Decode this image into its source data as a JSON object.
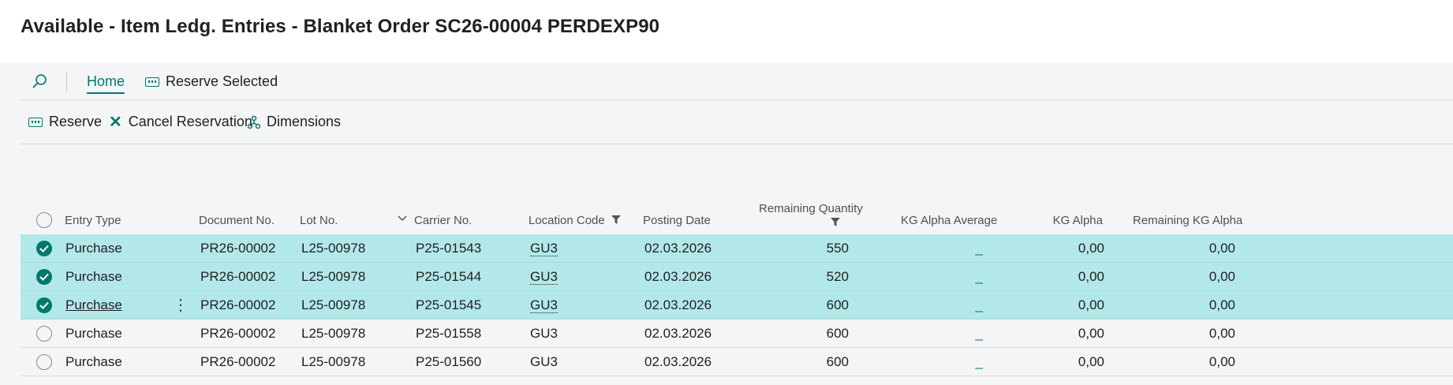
{
  "page": {
    "title": "Available - Item Ledg. Entries - Blanket Order SC26-00004 PERDEXP90"
  },
  "nav": {
    "home_label": "Home",
    "reserve_selected_label": "Reserve Selected"
  },
  "actions": {
    "reserve_label": "Reserve",
    "cancel_reservation_label": "Cancel Reservation",
    "dimensions_label": "Dimensions"
  },
  "columns": {
    "entry_type": "Entry Type",
    "document_no": "Document No.",
    "lot_no": "Lot No.",
    "carrier_no": "Carrier No.",
    "location_code": "Location Code",
    "posting_date": "Posting Date",
    "remaining_quantity": "Remaining Quantity",
    "kg_alpha_average": "KG Alpha Average",
    "kg_alpha": "KG Alpha",
    "remaining_kg_alpha": "Remaining KG Alpha"
  },
  "rows": [
    {
      "selected": true,
      "entry_type": "Purchase",
      "document_no": "PR26-00002",
      "lot_no": "L25-00978",
      "carrier_no": "P25-01543",
      "location_code": "GU3",
      "posting_date": "02.03.2026",
      "remaining_quantity": "550",
      "kg_alpha_average": "_",
      "kg_alpha": "0,00",
      "remaining_kg_alpha": "0,00"
    },
    {
      "selected": true,
      "entry_type": "Purchase",
      "document_no": "PR26-00002",
      "lot_no": "L25-00978",
      "carrier_no": "P25-01544",
      "location_code": "GU3",
      "posting_date": "02.03.2026",
      "remaining_quantity": "520",
      "kg_alpha_average": "_",
      "kg_alpha": "0,00",
      "remaining_kg_alpha": "0,00"
    },
    {
      "selected": true,
      "entry_type": "Purchase",
      "document_no": "PR26-00002",
      "lot_no": "L25-00978",
      "carrier_no": "P25-01545",
      "location_code": "GU3",
      "posting_date": "02.03.2026",
      "remaining_quantity": "600",
      "kg_alpha_average": "_",
      "kg_alpha": "0,00",
      "remaining_kg_alpha": "0,00"
    },
    {
      "selected": false,
      "entry_type": "Purchase",
      "document_no": "PR26-00002",
      "lot_no": "L25-00978",
      "carrier_no": "P25-01558",
      "location_code": "GU3",
      "posting_date": "02.03.2026",
      "remaining_quantity": "600",
      "kg_alpha_average": "_",
      "kg_alpha": "0,00",
      "remaining_kg_alpha": "0,00"
    },
    {
      "selected": false,
      "entry_type": "Purchase",
      "document_no": "PR26-00002",
      "lot_no": "L25-00978",
      "carrier_no": "P25-01560",
      "location_code": "GU3",
      "posting_date": "02.03.2026",
      "remaining_quantity": "600",
      "kg_alpha_average": "_",
      "kg_alpha": "0,00",
      "remaining_kg_alpha": "0,00"
    }
  ],
  "colors": {
    "accent": "#00796b",
    "selected_row": "#b3e8ea"
  }
}
